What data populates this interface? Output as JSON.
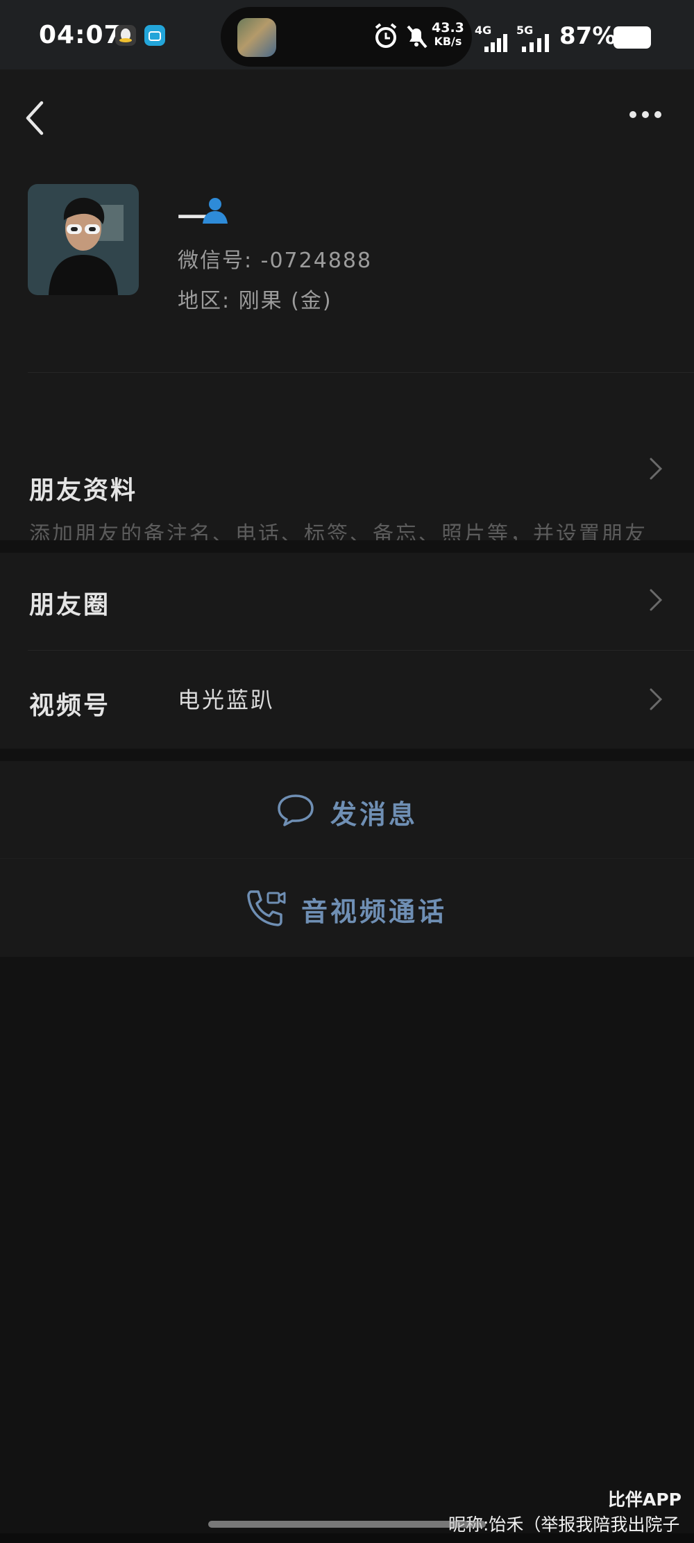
{
  "status_bar": {
    "time": "04:07",
    "net_speed_value": "43.3",
    "net_speed_unit": "KB/s",
    "sim1_tag": "4G",
    "sim2_tag": "5G",
    "battery_percent": "87%"
  },
  "header": {
    "back_icon": "chevron-left-icon",
    "more_icon": "ellipsis-icon"
  },
  "profile": {
    "nickname": "一",
    "wechat_id": "微信号: -0724888",
    "region": "地区: 刚果 (金)"
  },
  "friend_info": {
    "title": "朋友资料",
    "description": "添加朋友的备注名、电话、标签、备忘、照片等，并设置朋友权限。"
  },
  "moments": {
    "title": "朋友圈"
  },
  "channels": {
    "title": "视频号",
    "value": "电光蓝趴"
  },
  "actions": {
    "message_label": "发消息",
    "call_label": "音视频通话"
  },
  "watermark": {
    "app": "比伴APP",
    "nickname": "昵称:饴禾（举报我陪我出院子"
  },
  "colors": {
    "accent": "#6f8fb4",
    "person_icon": "#2e8bd8",
    "background": "#191919"
  }
}
